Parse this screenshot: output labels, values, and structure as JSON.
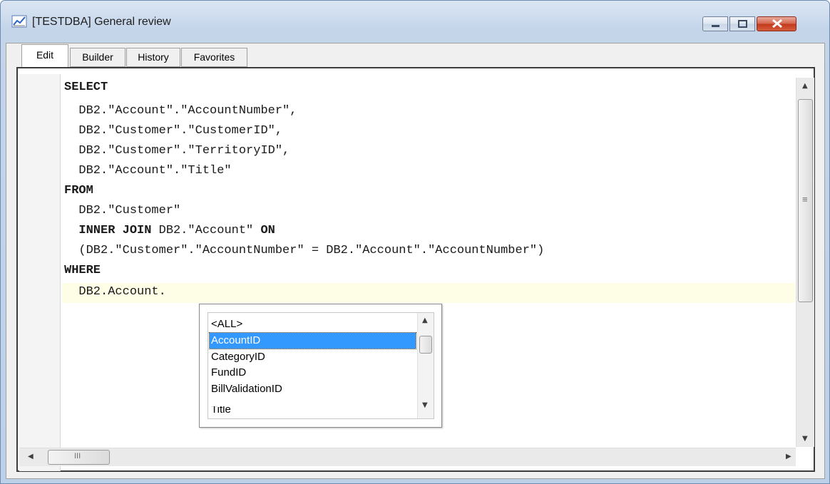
{
  "window": {
    "title": "[TESTDBA] General review"
  },
  "tabs": [
    {
      "label": "Edit",
      "active": true
    },
    {
      "label": "Builder",
      "active": false
    },
    {
      "label": "History",
      "active": false
    },
    {
      "label": "Favorites",
      "active": false
    }
  ],
  "editor": {
    "lines": [
      {
        "text": "SELECT",
        "keyword": true
      },
      {
        "text": "  DB2.\"Account\".\"AccountNumber\",",
        "keyword": false
      },
      {
        "text": "  DB2.\"Customer\".\"CustomerID\",",
        "keyword": false
      },
      {
        "text": "  DB2.\"Customer\".\"TerritoryID\",",
        "keyword": false
      },
      {
        "text": "  DB2.\"Account\".\"Title\"",
        "keyword": false
      },
      {
        "text": "FROM",
        "keyword": true
      },
      {
        "text": "  DB2.\"Customer\"",
        "keyword": false
      },
      {
        "text": "  INNER JOIN",
        "keyword": true
      },
      {
        "text": "  (DB2.\"Customer\".\"AccountNumber\" = DB2.\"Account\".\"AccountNumber\")",
        "keyword": false
      },
      {
        "text": "WHERE",
        "keyword": true
      },
      {
        "text": "  DB2.Account.",
        "keyword": false
      }
    ],
    "join_rest": " DB2.\"Account\" ",
    "join_on": "ON"
  },
  "autocomplete": {
    "items": [
      "<ALL>",
      "AccountID",
      "CategoryID",
      "FundID",
      "BillValidationID",
      "Title"
    ],
    "selected_index": 1
  },
  "scrollbars": {
    "hscroll_grip": "III",
    "vscroll_grip": "≡"
  },
  "colors": {
    "selection": "#3399ff",
    "current_line": "#fefde6",
    "close_button": "#c2391c"
  }
}
